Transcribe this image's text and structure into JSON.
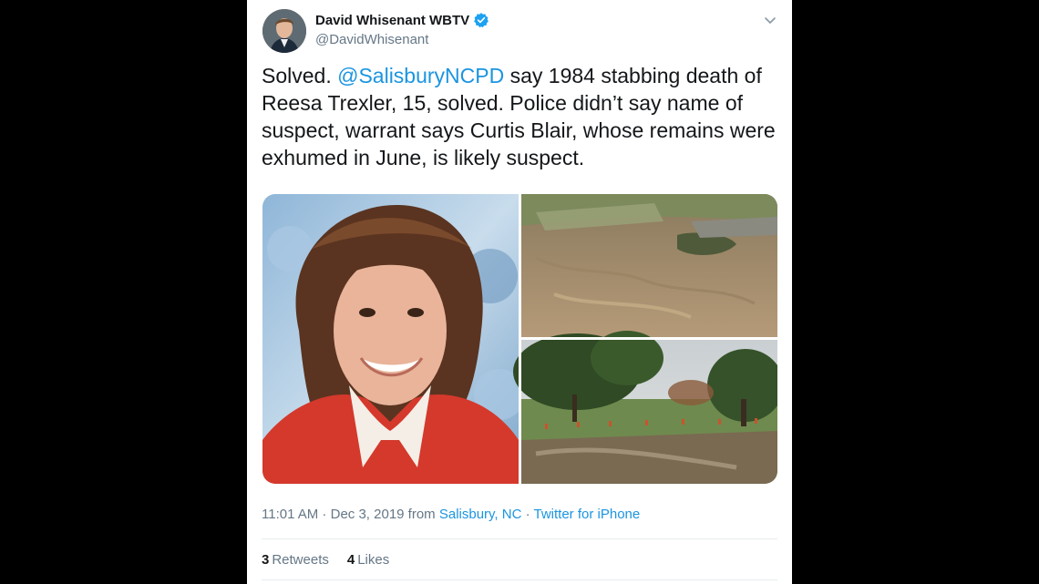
{
  "tweet": {
    "author": {
      "display_name": "David Whisenant WBTV",
      "handle": "@DavidWhisenant",
      "verified": true
    },
    "text": {
      "part1": "Solved. ",
      "mention": "@SalisburyNCPD",
      "part2": " say 1984 stabbing death of Reesa Trexler, 15, solved. Police didn’t say name of suspect, warrant says Curtis Blair, whose remains were exhumed in June, is likely suspect."
    },
    "media": {
      "photos": [
        "portrait-photo",
        "dirt-grave-photo",
        "cemetery-trees-photo"
      ]
    },
    "meta": {
      "time": "11:01 AM",
      "separator": " · ",
      "date": "Dec 3, 2019",
      "from": " from ",
      "location": "Salisbury, NC",
      "source": "Twitter for iPhone"
    },
    "stats": {
      "retweets_count": "3",
      "retweets_label": "Retweets",
      "likes_count": "4",
      "likes_label": "Likes"
    }
  },
  "colors": {
    "link": "#1b95e0",
    "text": "#14171a",
    "secondary": "#657786",
    "verified": "#1da1f2",
    "backdrop": "#000000"
  },
  "icons": [
    "verified-badge-icon",
    "chevron-down-icon"
  ]
}
